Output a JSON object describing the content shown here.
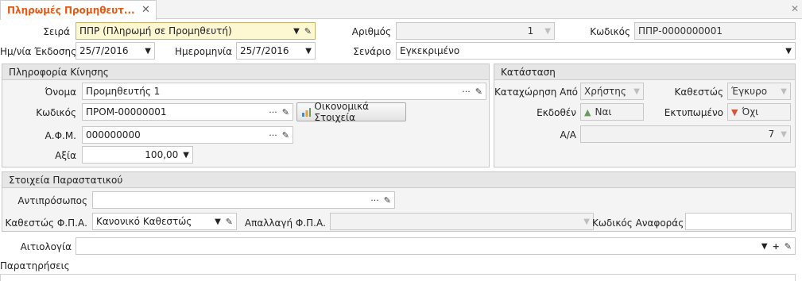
{
  "tab": {
    "title": "Πληρωμές Προμηθευτ...",
    "close": "✕"
  },
  "window": {
    "close": "✕"
  },
  "header": {
    "seira_label": "Σειρά",
    "seira_value": "ΠΠΡ (Πληρωμή σε Προμηθευτή)",
    "arithmos_label": "Αριθμός",
    "arithmos_value": "1",
    "kodikos_label": "Κωδικός",
    "kodikos_value": "ΠΠΡ-0000000001",
    "ekdosi_label": "Ημ/νία Έκδοσης",
    "ekdosi_value": "25/7/2016",
    "imerominia_label": "Ημερομηνία",
    "imerominia_value": "25/7/2016",
    "senario_label": "Σενάριο",
    "senario_value": "Εγκεκριμένο"
  },
  "kinisi": {
    "title": "Πληροφορία Κίνησης",
    "onoma_label": "Όνομα",
    "onoma_value": "Προμηθευτής 1",
    "kodikos_label": "Κωδικός",
    "kodikos_value": "ΠΡΟΜ-00000001",
    "oikonomika_button": "Οικονομικά Στοιχεία",
    "afm_label": "Α.Φ.Μ.",
    "afm_value": "000000000",
    "axia_label": "Αξία",
    "axia_value": "100,00"
  },
  "katastasi": {
    "title": "Κατάσταση",
    "kataxorisi_label": "Καταχώρηση Από",
    "kataxorisi_value": "Χρήστης",
    "status_label": "Καθεστώς",
    "status_value": "Έγκυρο",
    "ekdothen_label": "Εκδοθέν",
    "ekdothen_value": "Ναι",
    "ektypomeno_label": "Εκτυπωμένο",
    "ektypomeno_value": "Όχι",
    "aa_label": "Α/Α",
    "aa_value": "7"
  },
  "parastatiko": {
    "title": "Στοιχεία Παραστατικού",
    "antiprosopos_label": "Αντιπρόσωπος",
    "antiprosopos_value": "",
    "fpa_status_label": "Καθεστώς Φ.Π.Α.",
    "fpa_status_value": "Κανονικό Καθεστώς",
    "fpa_exempt_label": "Απαλλαγή Φ.Π.Α.",
    "fpa_exempt_value": "",
    "ref_code_label": "Κωδικός Αναφοράς",
    "ref_code_value": ""
  },
  "footer": {
    "aitiologia_label": "Αιτιολογία",
    "aitiologia_value": "",
    "paratiriseis_label": "Παρατηρήσεις"
  },
  "icons": {
    "ellipsis": "···",
    "pencil": "✎",
    "arrow": "▼",
    "plus": "+"
  },
  "colors": {
    "tab_title": "#e15a17",
    "thumb_up": "#6a9a5d",
    "thumb_down": "#d0573d"
  }
}
